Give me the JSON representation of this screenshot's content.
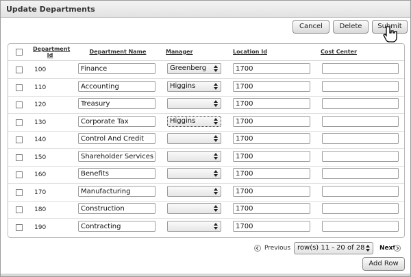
{
  "window": {
    "title": "Update Departments"
  },
  "toolbar": {
    "cancel_label": "Cancel",
    "delete_label": "Delete",
    "submit_label": "Submit"
  },
  "table": {
    "headers": {
      "department_id_line1": "Department",
      "department_id_line2": "Id",
      "department_name": "Department Name",
      "manager": "Manager",
      "location_id": "Location Id",
      "cost_center": "Cost Center"
    },
    "rows": [
      {
        "id": "100",
        "name": "Finance",
        "manager": "Greenberg",
        "location": "1700",
        "cost": ""
      },
      {
        "id": "110",
        "name": "Accounting",
        "manager": "Higgins",
        "location": "1700",
        "cost": ""
      },
      {
        "id": "120",
        "name": "Treasury",
        "manager": "",
        "location": "1700",
        "cost": ""
      },
      {
        "id": "130",
        "name": "Corporate Tax",
        "manager": "Higgins",
        "location": "1700",
        "cost": ""
      },
      {
        "id": "140",
        "name": "Control And Credit",
        "manager": "",
        "location": "1700",
        "cost": ""
      },
      {
        "id": "150",
        "name": "Shareholder Services",
        "manager": "",
        "location": "1700",
        "cost": ""
      },
      {
        "id": "160",
        "name": "Benefits",
        "manager": "",
        "location": "1700",
        "cost": ""
      },
      {
        "id": "170",
        "name": "Manufacturing",
        "manager": "",
        "location": "1700",
        "cost": ""
      },
      {
        "id": "180",
        "name": "Construction",
        "manager": "",
        "location": "1700",
        "cost": ""
      },
      {
        "id": "190",
        "name": "Contracting",
        "manager": "",
        "location": "1700",
        "cost": ""
      }
    ]
  },
  "pagination": {
    "previous_label": "Previous",
    "next_label": "Next",
    "range_label": "row(s) 11 - 20 of 28"
  },
  "footer": {
    "add_row_label": "Add Row"
  },
  "icons": {
    "cursor": "hand-pointer-icon",
    "select_arrows": "updown-arrows-icon"
  }
}
